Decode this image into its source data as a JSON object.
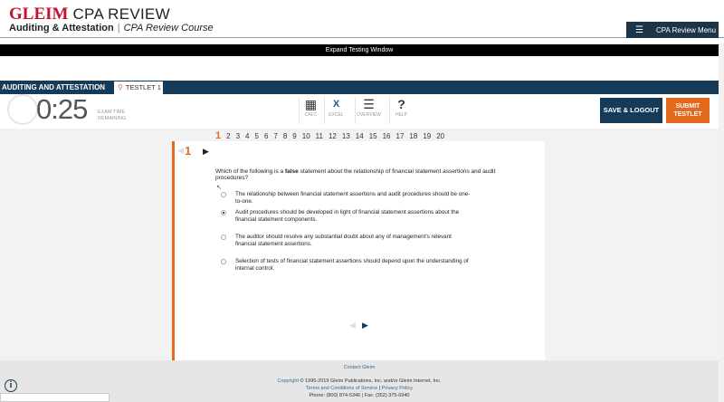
{
  "header": {
    "brand": "GLEIM",
    "product": "CPA REVIEW",
    "course_section": "Auditing & Attestation",
    "course_name": "CPA Review Course",
    "menu_label": "CPA Review Menu"
  },
  "expand_bar": {
    "label": "Expand Testing Window"
  },
  "testbar": {
    "section": "AUDITING AND ATTESTATION",
    "testlet_tab": "TESTLET 1"
  },
  "timer": {
    "value": "0:25",
    "label": "EXAM TIME REMAINING"
  },
  "tools": [
    {
      "icon": "calculator-icon",
      "label": "CALC"
    },
    {
      "icon": "excel-icon",
      "label": "EXCEL"
    },
    {
      "icon": "overview-icon",
      "label": "OVERVIEW"
    },
    {
      "icon": "help-icon",
      "label": "HELP"
    }
  ],
  "buttons": {
    "save_logout": "SAVE & LOGOUT",
    "submit_line1": "SUBMIT",
    "submit_line2": "TESTLET"
  },
  "question_nav": {
    "active": "1",
    "numbers": [
      "2",
      "3",
      "4",
      "5",
      "6",
      "7",
      "8",
      "9",
      "10",
      "11",
      "12",
      "13",
      "14",
      "15",
      "16",
      "17",
      "18",
      "19",
      "20"
    ]
  },
  "question": {
    "number": "1",
    "text_before": "Which of the following is a ",
    "text_bold": "false",
    "text_after": " statement about the relationship of financial statement assertions and audit procedures?",
    "options": [
      {
        "text": "The relationship between financial statement assertions and audit procedures should be one-to-one.",
        "selected": false
      },
      {
        "text": "Audit procedures should be developed in light of financial statement assertions about the financial statement components.",
        "selected": true
      },
      {
        "text": "The auditor should resolve any substantial doubt about any of management's relevant financial statement assertions.",
        "selected": false
      },
      {
        "text": "Selection of tests of financial statement assertions should depend upon the understanding of internal control.",
        "selected": false
      }
    ]
  },
  "footer": {
    "contact": "Contact Gleim",
    "copyright_link": "Copyright",
    "copyright_text": " © 1995-2019 Gleim Publications, Inc. and/or Gleim Internet, Inc.",
    "terms": "Terms and Conditions of Service",
    "privacy": "Privacy Policy",
    "phone": "Phone: (800) 874-5346 | Fax: (352) 375-6940"
  },
  "colors": {
    "navy": "#163b58",
    "orange": "#e36a1d",
    "brand_red": "#c8102e"
  }
}
